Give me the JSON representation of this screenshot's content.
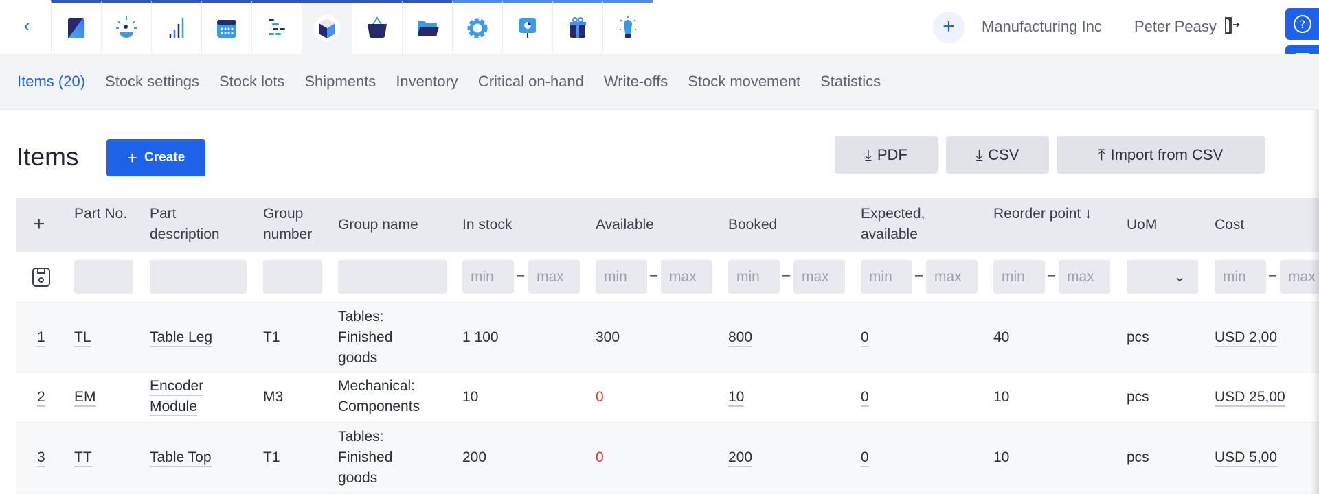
{
  "topbar": {
    "apps": [
      "dashboard",
      "alerts",
      "analytics",
      "calendar",
      "planning",
      "stock",
      "sales",
      "documents",
      "settings",
      "presentations",
      "gifts",
      "ideas"
    ],
    "active_app": "stock",
    "company": "Manufacturing Inc",
    "user": "Peter Peasy"
  },
  "subnav": {
    "tabs": [
      "Items (20)",
      "Stock settings",
      "Stock lots",
      "Shipments",
      "Inventory",
      "Critical on-hand",
      "Write-offs",
      "Stock movement",
      "Statistics"
    ]
  },
  "page": {
    "title": "Items",
    "create_label": "Create",
    "pdf_label": "PDF",
    "csv_label": "CSV",
    "import_label": "Import from CSV"
  },
  "table": {
    "headers": {
      "part_no": "Part No.",
      "part_desc": "Part description",
      "group_number": "Group number",
      "group_name": "Group name",
      "in_stock": "In stock",
      "available": "Available",
      "booked": "Booked",
      "expected": "Expected, available",
      "reorder": "Reorder point ↓",
      "uom": "UoM",
      "cost": "Cost"
    },
    "filter": {
      "min": "min",
      "max": "max",
      "dash": "–"
    },
    "rows": [
      {
        "n": "1",
        "part_no": "TL",
        "desc": "Table Leg",
        "group_number": "T1",
        "group_name": "Tables: Finished goods",
        "in_stock": "1 100",
        "available": "300",
        "booked": "800",
        "expected": "0",
        "reorder": "40",
        "uom": "pcs",
        "cost": "USD 2,00"
      },
      {
        "n": "2",
        "part_no": "EM",
        "desc": "Encoder Module",
        "group_number": "M3",
        "group_name": "Mechanical: Components",
        "in_stock": "10",
        "available": "0",
        "booked": "10",
        "expected": "0",
        "reorder": "10",
        "uom": "pcs",
        "cost": "USD 25,00"
      },
      {
        "n": "3",
        "part_no": "TT",
        "desc": "Table Top",
        "group_number": "T1",
        "group_name": "Tables: Finished goods",
        "in_stock": "200",
        "available": "0",
        "booked": "200",
        "expected": "0",
        "reorder": "10",
        "uom": "pcs",
        "cost": "USD 5,00"
      }
    ]
  }
}
